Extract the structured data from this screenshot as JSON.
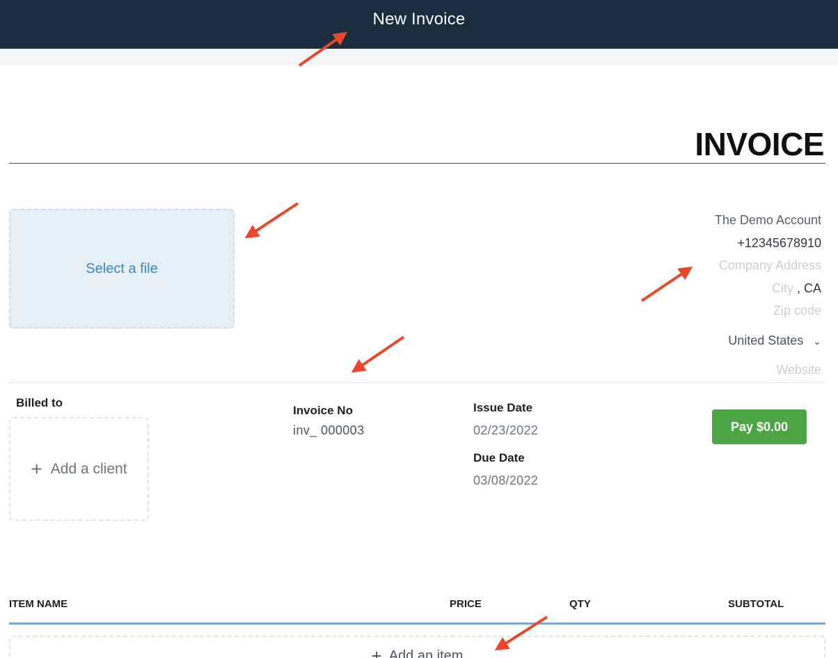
{
  "header": {
    "title": "New Invoice"
  },
  "invoice": {
    "heading": "INVOICE"
  },
  "logo": {
    "label": "Select a file"
  },
  "company": {
    "name": "The Demo Account",
    "phone": "+12345678910",
    "address_placeholder": "Company Address",
    "city_placeholder": "City",
    "city_separator": ",",
    "state": "CA",
    "zip_placeholder": "Zip code",
    "country": "United States",
    "website_placeholder": "Website"
  },
  "billed_to": {
    "label": "Billed to",
    "add_client_icon": "+",
    "add_client": "Add a client"
  },
  "invoice_no": {
    "label": "Invoice No",
    "prefix": "inv_",
    "number": "000003"
  },
  "dates": {
    "issue_label": "Issue Date",
    "issue_value": "02/23/2022",
    "due_label": "Due Date",
    "due_value": "03/08/2022"
  },
  "pay_button": {
    "label": "Pay $0.00"
  },
  "items_table": {
    "columns": [
      "ITEM NAME",
      "PRICE",
      "QTY",
      "SUBTOTAL"
    ],
    "add_item_icon": "+",
    "add_item": "Add an item"
  },
  "colors": {
    "topbar": "#192d3e",
    "accent_blue": "#3a87c8",
    "pay_green": "#4ca646",
    "annotation_arrow": "#e8472b"
  },
  "icons": {
    "country_dropdown": "chevron-down-icon",
    "add_client": "plus-icon",
    "add_item": "plus-icon"
  }
}
